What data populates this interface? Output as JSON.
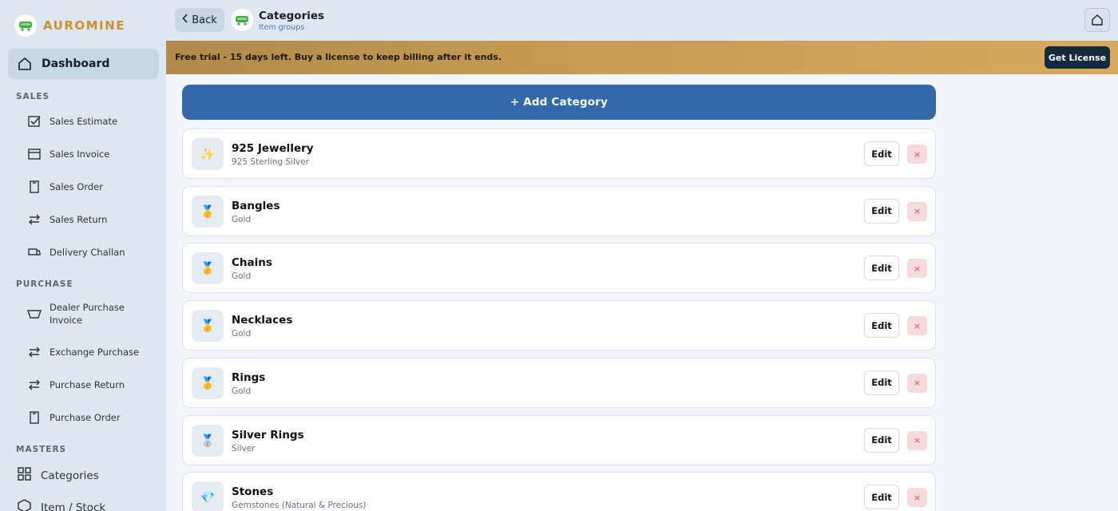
{
  "brand": {
    "name": "AUROMINE"
  },
  "sidebar": {
    "dashboard_label": "Dashboard",
    "sections": {
      "sales": "SALES",
      "purchase": "PURCHASE",
      "masters": "MASTERS"
    },
    "sales_items": [
      {
        "label": "Sales Estimate",
        "icon": "checkbox-icon"
      },
      {
        "label": "Sales Invoice",
        "icon": "invoice-icon"
      },
      {
        "label": "Sales Order",
        "icon": "order-icon"
      },
      {
        "label": "Sales Return",
        "icon": "swap-arrows-icon"
      },
      {
        "label": "Delivery Challan",
        "icon": "truck-icon"
      }
    ],
    "purchase_items": [
      {
        "label": "Dealer Purchase Invoice",
        "icon": "basket-icon"
      },
      {
        "label": "Exchange Purchase",
        "icon": "swap-arrows-icon"
      },
      {
        "label": "Purchase Return",
        "icon": "swap-arrows-icon"
      },
      {
        "label": "Purchase Order",
        "icon": "order-icon"
      }
    ],
    "masters_items": [
      {
        "label": "Categories",
        "icon": "grid-icon"
      },
      {
        "label": "Item / Stock",
        "icon": "box-icon"
      }
    ]
  },
  "header": {
    "back_label": "Back",
    "title": "Categories",
    "subtitle": "Item groups"
  },
  "banner": {
    "text": "Free trial - 15 days left. Buy a license to keep billing after it ends.",
    "button_label": "Get License"
  },
  "main": {
    "add_label": "+ Add Category",
    "edit_label": "Edit",
    "delete_label": "×",
    "categories": [
      {
        "name": "925 Jewellery",
        "desc": "925 Sterling Silver",
        "icon": "✨"
      },
      {
        "name": "Bangles",
        "desc": "Gold",
        "icon": "🥇"
      },
      {
        "name": "Chains",
        "desc": "Gold",
        "icon": "🥇"
      },
      {
        "name": "Necklaces",
        "desc": "Gold",
        "icon": "🥇"
      },
      {
        "name": "Rings",
        "desc": "Gold",
        "icon": "🥇"
      },
      {
        "name": "Silver Rings",
        "desc": "Silver",
        "icon": "🥈"
      },
      {
        "name": "Stones",
        "desc": "Gemstones (Natural & Precious)",
        "icon": "💎"
      }
    ]
  },
  "colors": {
    "brand_gold": "#c9922d",
    "primary_blue": "#3169ab",
    "license_navy": "#13293d",
    "danger_red": "#d9505d"
  }
}
